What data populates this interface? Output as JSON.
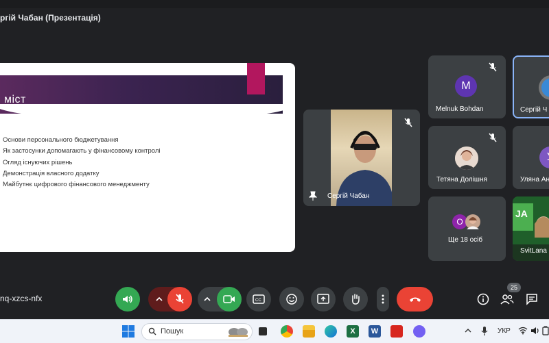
{
  "window": {
    "title": "ргій Чабан (Презентація)"
  },
  "slide": {
    "title": "міст",
    "bullets": [
      "Основи персонального бюджетування",
      "Як застосунки допомагають у фінансовому контролі",
      "Огляд існуючих рішень",
      "Демонстрація власного додатку",
      "Майбутнє цифрового фінансового менеджменту"
    ]
  },
  "participants": {
    "presenter": {
      "name": "Сергій Чабан"
    },
    "melnuk": {
      "name": "Melnuk Bohdan",
      "initial": "M"
    },
    "serhii_cut": {
      "name": "Сергій Ч"
    },
    "tetiana": {
      "name": "Тетяна Долішня"
    },
    "uliana": {
      "name": "Уляна Ан",
      "initial": "У"
    },
    "more": {
      "label": "Ще 18 осіб",
      "initial": "O"
    },
    "svitlana": {
      "name": "SvitLana"
    }
  },
  "controls": {
    "meeting_code": "nq-xzcs-nfx",
    "participant_count": "25"
  },
  "taskbar": {
    "search_placeholder": "Пошук",
    "language": "УКР"
  },
  "colors": {
    "end_call": "#ea4335",
    "active_green": "#34a853",
    "mic_off_red": "#ea4335",
    "accent": "#8ab4f8"
  }
}
